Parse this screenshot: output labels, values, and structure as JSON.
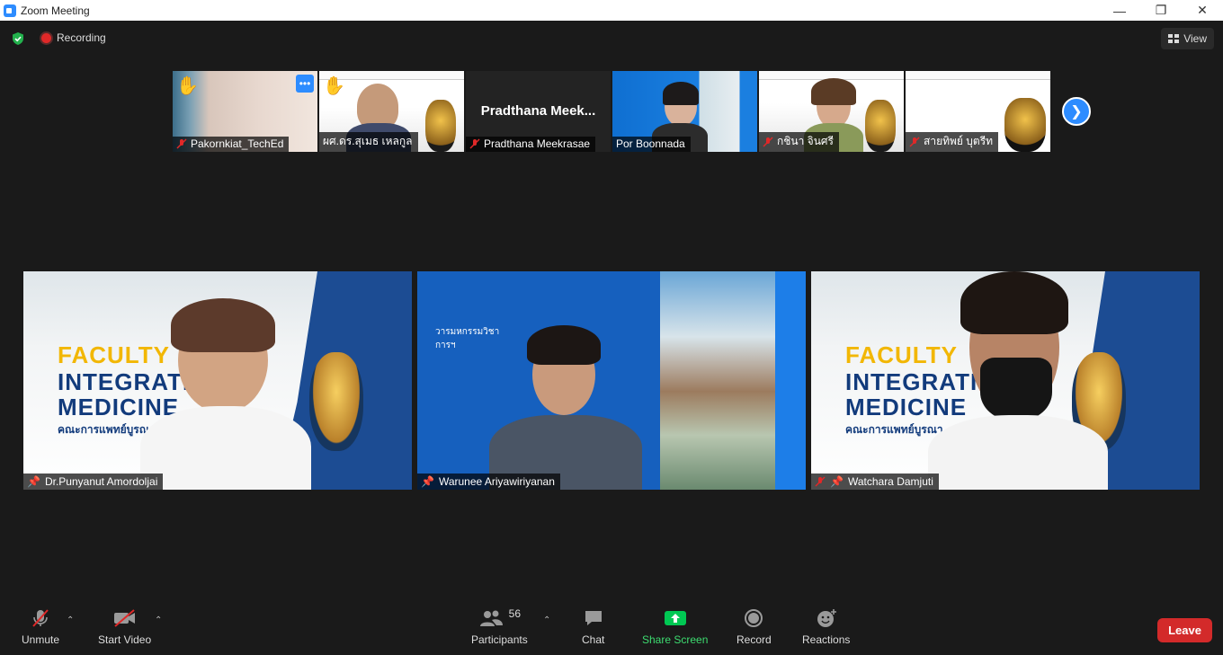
{
  "window": {
    "title": "Zoom Meeting"
  },
  "topbar": {
    "recording_label": "Recording",
    "view_label": "View"
  },
  "strip": {
    "participants": [
      {
        "name": "Pakornkiat_TechEd"
      },
      {
        "name": "ผศ.ดร.สุเมธ เหลกูล"
      },
      {
        "name": "Pradthana Meekrasae",
        "display": "Pradthana  Meek..."
      },
      {
        "name": "Por Boonnada"
      },
      {
        "name": "กชินา  จินศรี"
      },
      {
        "name": "สายทิพย์  บุตรีท"
      }
    ]
  },
  "gallery": {
    "tiles": [
      {
        "name": "Dr.Punyanut Amordoljai",
        "banner_line1": "FACULTY",
        "banner_line2": "INTEGRATI",
        "banner_line3": "MEDICINE",
        "banner_sub": "คณะการแพทย์บูรณาการ"
      },
      {
        "name": "Warunee Ariyawiriyanan",
        "banner_sub": "วารมหกรรมวิชาการฯ"
      },
      {
        "name": "Watchara Damjuti",
        "banner_line1": "FACULTY",
        "banner_line2": "INTEGRATI",
        "banner_line3": "MEDICINE",
        "banner_sub": "คณะการแพทย์บูรณา"
      }
    ]
  },
  "toolbar": {
    "unmute": "Unmute",
    "start_video": "Start Video",
    "participants": "Participants",
    "participant_count": "56",
    "chat": "Chat",
    "share_screen": "Share Screen",
    "record": "Record",
    "reactions": "Reactions",
    "leave": "Leave"
  },
  "colors": {
    "accent": "#2d8cff",
    "share": "#00c853",
    "leave": "#d32a2a",
    "recording": "#e02828"
  }
}
